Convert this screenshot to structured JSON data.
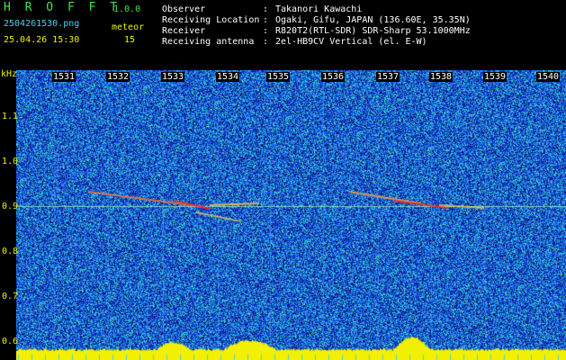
{
  "header": {
    "app_name": "H R O F F T",
    "version": "1.0.0",
    "filename": "2504261530.png",
    "datetime": "25.04.26 15:30",
    "count_label": "meteor",
    "count_value": "15",
    "info_labels": [
      "Observer",
      "Receiving Location",
      "Receiver",
      "Receiving antenna"
    ],
    "info_sep": ":",
    "info_values": [
      "Takanori Kawachi",
      "Ogaki, Gifu, JAPAN (136.60E, 35.35N)",
      "R820T2(RTL-SDR) SDR-Sharp 53.1000MHz",
      "2el-HB9CV Vertical (el. E-W)"
    ]
  },
  "y_axis": {
    "unit": "kHz",
    "ticks": [
      "1.1",
      "1.0",
      "0.9",
      "0.8",
      "0.7",
      "0.6"
    ]
  },
  "x_axis": {
    "ticks": [
      "1531",
      "1532",
      "1533",
      "1534",
      "1535",
      "1536",
      "1537",
      "1538",
      "1539",
      "1540"
    ]
  },
  "colors": {
    "background": "#000000",
    "spectrogram_base": "#1a3fd0",
    "noise_floor": "#f0f000",
    "header_green": "#46e04a",
    "header_cyan": "#4ed0f0",
    "header_yellow": "#f0f000"
  }
}
